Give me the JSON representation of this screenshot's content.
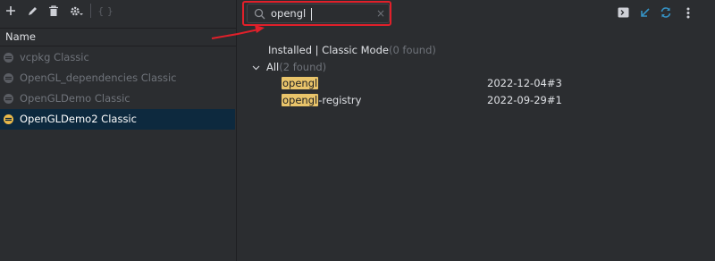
{
  "left_panel": {
    "toolbar": {
      "add": "add-icon",
      "edit": "pencil-icon",
      "delete": "trash-icon",
      "settings": "gear-icon",
      "json": "{ }"
    },
    "column_header": "Name",
    "profiles": [
      {
        "label": "vcpkg Classic",
        "selected": false
      },
      {
        "label": "OpenGL_dependencies Classic",
        "selected": false
      },
      {
        "label": "OpenGLDemo Classic",
        "selected": false
      },
      {
        "label": "OpenGLDemo2 Classic",
        "selected": true
      }
    ]
  },
  "right_panel": {
    "search": {
      "value": "opengl",
      "clear": "×"
    },
    "toolbar_icons": [
      "terminal-icon",
      "import-icon",
      "refresh-icon",
      "more-icon"
    ],
    "installed_label": "Installed | Classic Mode",
    "installed_count": "(0 found)",
    "all_label": "All",
    "all_count": "(2 found)",
    "results": [
      {
        "match": "opengl",
        "rest": "",
        "version": "2022-12-04#3"
      },
      {
        "match": "opengl",
        "rest": "-registry",
        "version": "2022-09-29#1"
      }
    ]
  },
  "colors": {
    "background": "#2b2d30",
    "selection": "#0d293e",
    "match_highlight": "#e9c46a",
    "annotation_red": "#e0202a",
    "accent_blue": "#3592c4"
  }
}
